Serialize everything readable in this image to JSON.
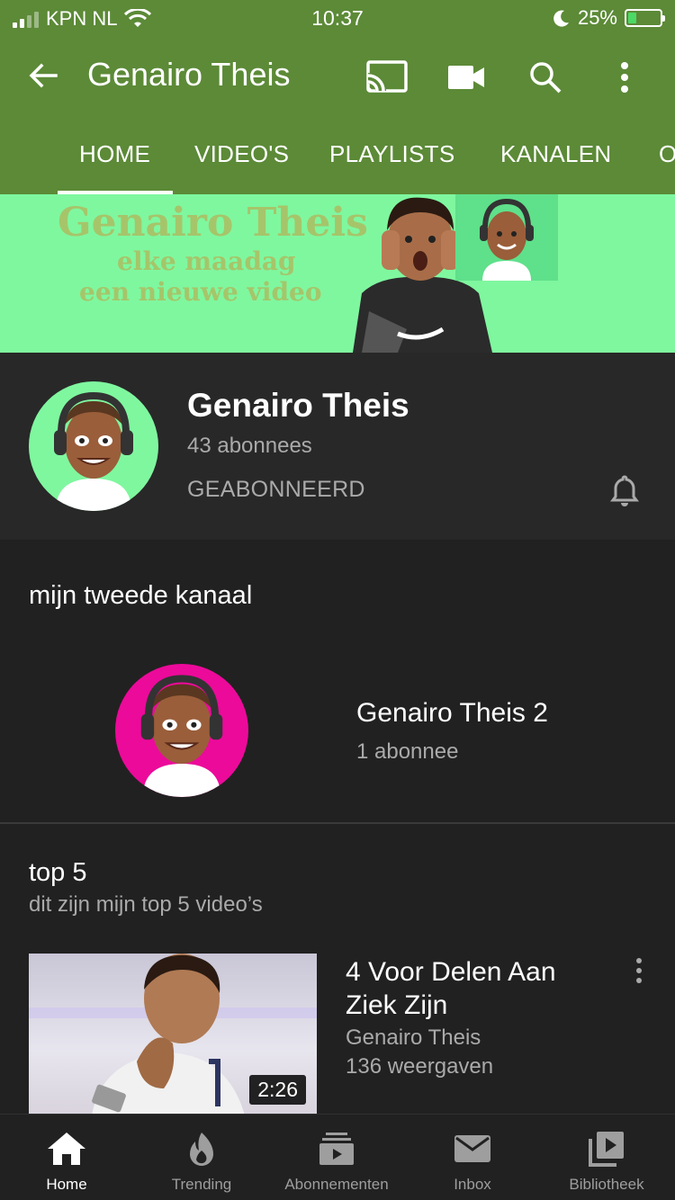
{
  "status_bar": {
    "carrier": "KPN NL",
    "time": "10:37",
    "battery": "25%",
    "battery_level": 0.25
  },
  "app_bar": {
    "title": "Genairo Theis",
    "icons": [
      "back-arrow-icon",
      "cast-icon",
      "video-camera-icon",
      "search-icon",
      "more-vert-icon"
    ]
  },
  "tabs": [
    "HOME",
    "VIDEO'S",
    "PLAYLISTS",
    "KANALEN",
    "O"
  ],
  "banner": {
    "line1": "Genairo Theis",
    "line2": "elke maadag",
    "line3": "een nieuwe video"
  },
  "channel": {
    "name": "Genairo Theis",
    "subscribers": "43 abonnees",
    "subscribed_label": "GEABONNEERD"
  },
  "featured_channels": {
    "title": "mijn tweede kanaal",
    "channel_name": "Genairo Theis 2",
    "subscribers": "1 abonnee"
  },
  "shelf": {
    "title": "top 5",
    "subtitle": "dit zijn mijn top 5 video’s",
    "video": {
      "title": "4 Voor Delen Aan Ziek Zijn",
      "channel": "Genairo Theis",
      "views": "136 weergaven",
      "duration": "2:26"
    }
  },
  "bottom_nav": {
    "items": [
      {
        "label": "Home",
        "icon": "home-icon"
      },
      {
        "label": "Trending",
        "icon": "flame-icon"
      },
      {
        "label": "Abonnementen",
        "icon": "subscriptions-icon"
      },
      {
        "label": "Inbox",
        "icon": "mail-icon"
      },
      {
        "label": "Bibliotheek",
        "icon": "library-icon"
      }
    ]
  },
  "colors": {
    "header": "#5c8a37",
    "background": "#212121",
    "banner": "#7ff79f",
    "avatar2": "#ec0a9a"
  }
}
